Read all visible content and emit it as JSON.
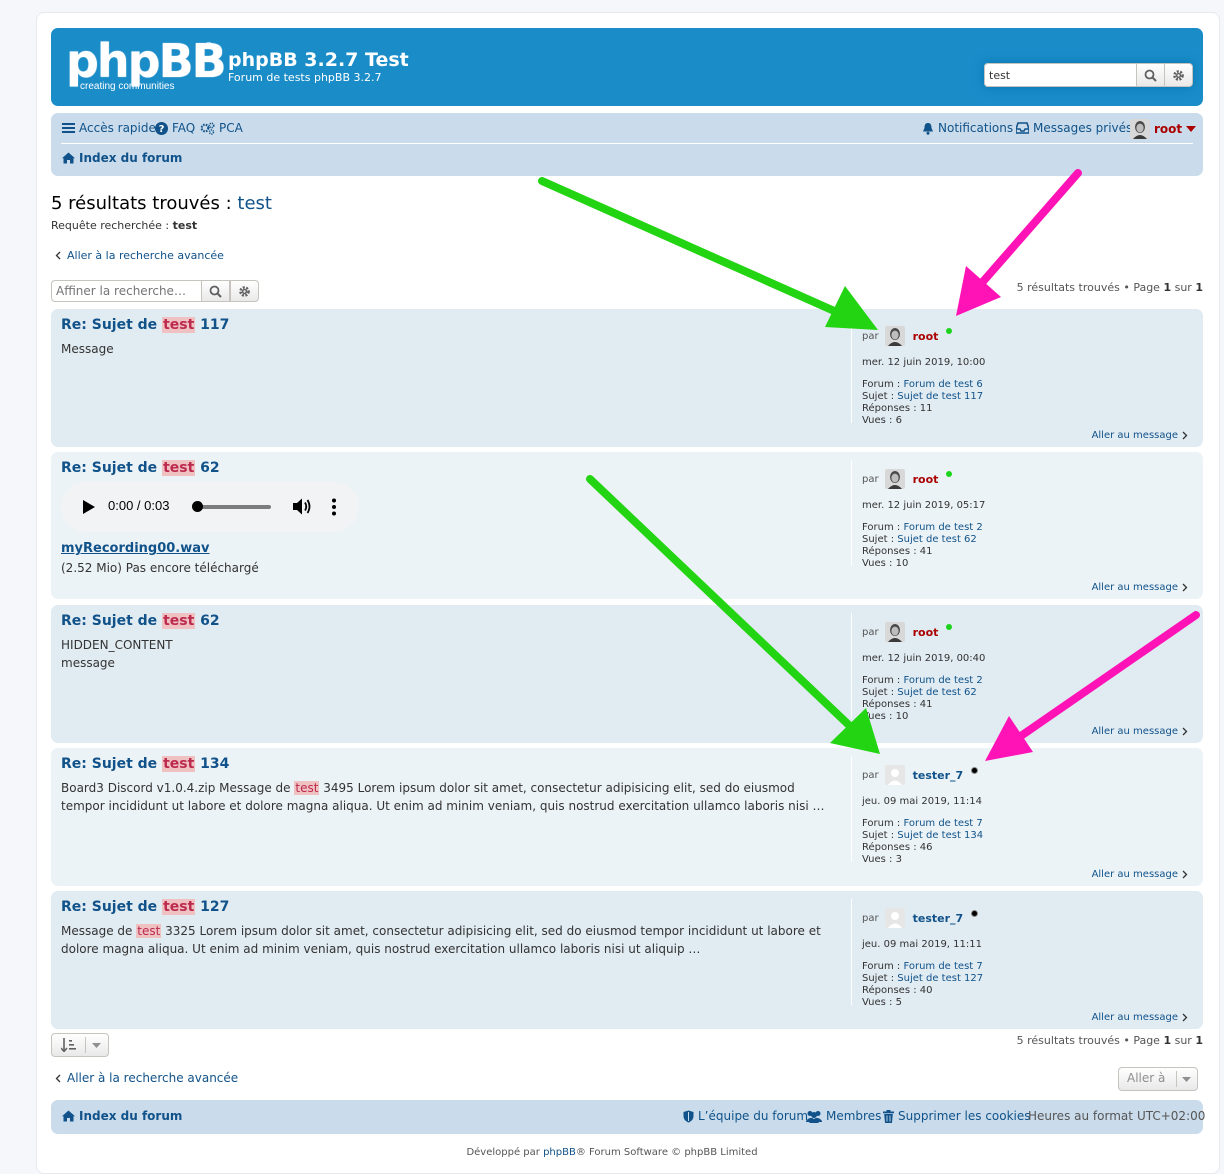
{
  "header": {
    "logo_text": "phpBB",
    "logo_reg": "®",
    "logo_tagline": "creating communities",
    "site_title": "phpBB 3.2.7 Test",
    "site_description": "Forum de tests phpBB 3.2.7",
    "search_value": "test"
  },
  "navbar": {
    "quick_access": "Accès rapide",
    "faq": "FAQ",
    "ucp": "PCA",
    "notifications": "Notifications",
    "private_messages": "Messages privés",
    "username": "root",
    "breadcrumb_index": "Index du forum"
  },
  "search": {
    "heading_prefix": "5 résultats trouvés :",
    "heading_query": "test",
    "query_label": "Requête recherchée :",
    "query_value": "test",
    "advanced_link": "Aller à la recherche avancée",
    "refine_placeholder": "Affiner la recherche…",
    "pagination_prefix": "5 résultats trouvés • Page",
    "page_current": "1",
    "page_of": "sur",
    "page_total": "1"
  },
  "labels": {
    "by": "par",
    "forum": "Forum :",
    "topic": "Sujet :",
    "replies": "Réponses :",
    "views": "Vues :",
    "goto_post": "Aller au message"
  },
  "results": [
    {
      "title_pre": "Re: Sujet de",
      "title_hl": "test",
      "title_post": "117",
      "author": "root",
      "author_online": true,
      "date": "mer. 12 juin 2019, 10:00",
      "forum": "Forum de test 6",
      "topic": "Sujet de test 117",
      "replies": "11",
      "views": "6",
      "body_lines": [
        "Message"
      ]
    },
    {
      "title_pre": "Re: Sujet de",
      "title_hl": "test",
      "title_post": "62",
      "author": "root",
      "author_online": true,
      "date": "mer. 12 juin 2019, 05:17",
      "forum": "Forum de test 2",
      "topic": "Sujet de test 62",
      "replies": "41",
      "views": "10",
      "audio_time": "0:00 / 0:03",
      "audio_progress": 0.0,
      "attachment_name": "myRecording00.wav",
      "attachment_info": "(2.52 Mio) Pas encore téléchargé"
    },
    {
      "title_pre": "Re: Sujet de",
      "title_hl": "test",
      "title_post": "62",
      "author": "root",
      "author_online": true,
      "date": "mer. 12 juin 2019, 00:40",
      "forum": "Forum de test 2",
      "topic": "Sujet de test 62",
      "replies": "41",
      "views": "10",
      "body_lines": [
        "HIDDEN_CONTENT",
        "message"
      ]
    },
    {
      "title_pre": "Re: Sujet de",
      "title_hl": "test",
      "title_post": "134",
      "author": "tester_7",
      "author_online": false,
      "date": "jeu. 09 mai 2019, 11:14",
      "forum": "Forum de test 7",
      "topic": "Sujet de test 134",
      "replies": "46",
      "views": "3",
      "body_pre": "Board3 Discord v1.0.4.zip Message de",
      "body_hl": "test",
      "body_post": "3495 Lorem ipsum dolor sit amet, consectetur adipisicing elit, sed do eiusmod tempor incididunt ut labore et dolore magna aliqua. Ut enim ad minim veniam, quis nostrud exercitation ullamco laboris nisi …"
    },
    {
      "title_pre": "Re: Sujet de",
      "title_hl": "test",
      "title_post": "127",
      "author": "tester_7",
      "author_online": false,
      "date": "jeu. 09 mai 2019, 11:11",
      "forum": "Forum de test 7",
      "topic": "Sujet de test 127",
      "replies": "40",
      "views": "5",
      "body_pre": "Message de",
      "body_hl": "test",
      "body_post": "3325 Lorem ipsum dolor sit amet, consectetur adipisicing elit, sed do eiusmod tempor incididunt ut labore et dolore magna aliqua. Ut enim ad minim veniam, quis nostrud exercitation ullamco laboris nisi ut aliquip …"
    }
  ],
  "bottom": {
    "jump_label": "Aller à"
  },
  "footer": {
    "index": "Index du forum",
    "team": "L’équipe du forum",
    "members": "Membres",
    "delete_cookies": "Supprimer les cookies",
    "timezone_label": "Heures au format",
    "timezone_value": "UTC+02:00",
    "copyright_pre": "Développé par",
    "copyright_link": "phpBB",
    "copyright_post": "® Forum Software © phpBB Limited"
  },
  "colors": {
    "accent": "#105289",
    "header_blue": "#1a8cc8",
    "navbar": "#cadceb",
    "highlight": "#efc1c1",
    "admin_name": "#aa0000",
    "online": "#1bd41b",
    "arrow_green": "#22d411",
    "arrow_pink": "#ff13b6"
  }
}
